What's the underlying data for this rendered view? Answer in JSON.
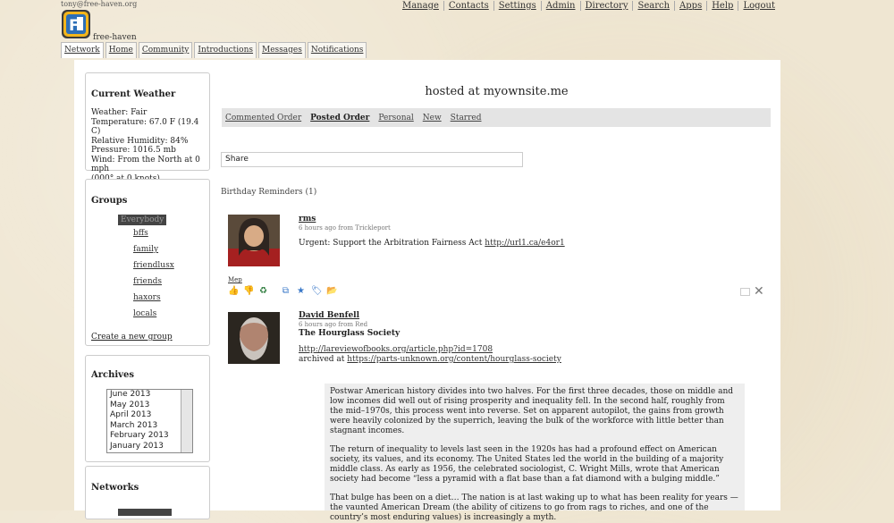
{
  "header": {
    "user_email": "tony@free-haven.org",
    "site_name": "free-haven",
    "nav": [
      "Manage",
      "Contacts",
      "Settings",
      "Admin",
      "Directory",
      "Search",
      "Apps",
      "Help",
      "Logout"
    ],
    "tabs": [
      "Network",
      "Home",
      "Community",
      "Introductions",
      "Messages",
      "Notifications"
    ]
  },
  "weather": {
    "title": "Current Weather",
    "lines": [
      "Weather: Fair",
      "Temperature: 67.0 F (19.4 C)",
      "Relative Humidity: 84%",
      "Pressure: 1016.5 mb",
      "Wind: From the North at 0 mph",
      "(000° at 0 knots)"
    ]
  },
  "groups": {
    "title": "Groups",
    "everybody": "Everybody",
    "items": [
      "bffs",
      "family",
      "friendlusx",
      "friends",
      "haxors",
      "locals"
    ],
    "create": "Create a new group"
  },
  "archives": {
    "title": "Archives",
    "months": [
      "June 2013",
      "May 2013",
      "April 2013",
      "March 2013",
      "February 2013",
      "January 2013"
    ]
  },
  "networks": {
    "title": "Networks"
  },
  "main": {
    "title": "hosted at myownsite.me",
    "sort_tabs": [
      "Commented Order",
      "Posted Order",
      "Personal",
      "New",
      "Starred"
    ],
    "share_placeholder": "Share",
    "birthday": "Birthday Reminders (1)"
  },
  "posts": [
    {
      "author": "rms",
      "meta": "6 hours ago from Trickleport",
      "text": "Urgent: Support the Arbitration Fairness Act ",
      "link": "http://url1.ca/e4or1",
      "more": "Mep"
    },
    {
      "author": "David Benfell",
      "meta": "6 hours ago from Red",
      "title": "The Hourglass Society",
      "link1": "http://lareviewofbooks.org/article.php?id=1708",
      "archived_prefix": "archived at ",
      "link2": "https://parts-unknown.org/content/hourglass-society",
      "quote": [
        "Postwar American history divides into two halves. For the first three decades, those on middle and low incomes did well out of rising prosperity and inequality fell. In the second half, roughly from the mid–1970s, this process went into reverse. Set on apparent autopilot, the gains from growth were heavily colonized by the superrich, leaving the bulk of the workforce with little better than stagnant incomes.",
        "The return of inequality to levels last seen in the 1920s has had a profound effect on American society, its values, and its economy. The United States led the world in the building of a majority middle class. As early as 1956, the celebrated sociologist, C. Wright Mills, wrote that American society had become “less a pyramid with a flat base than a fat diamond with a bulging middle.”",
        "That bulge has been on a diet… The nation is at last waking up to what has been reality for years — the vaunted American Dream (the ability of citizens to go from rags to riches, and one of the country’s most enduring values) is increasingly a myth."
      ]
    }
  ]
}
